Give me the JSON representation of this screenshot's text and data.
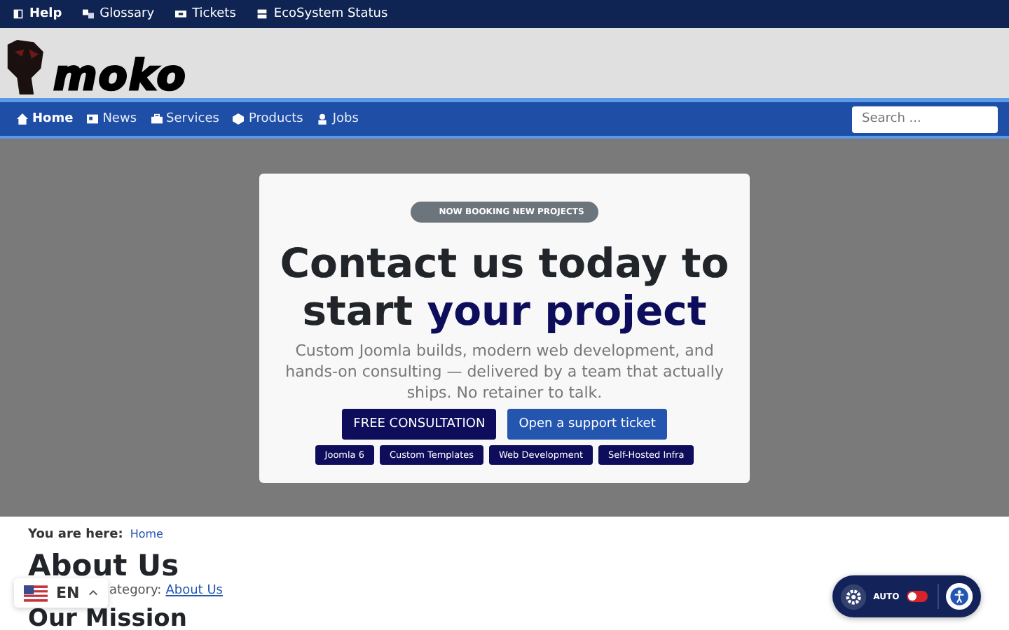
{
  "top_bar": {
    "items": [
      {
        "label": "Help",
        "bold": true
      },
      {
        "label": "Glossary",
        "bold": false
      },
      {
        "label": "Tickets",
        "bold": false
      },
      {
        "label": "EcoSystem Status",
        "bold": false
      }
    ]
  },
  "logo": {
    "text": "moko"
  },
  "nav": {
    "items": [
      {
        "label": "Home",
        "selected": true
      },
      {
        "label": "News",
        "selected": false
      },
      {
        "label": "Services",
        "selected": false
      },
      {
        "label": "Products",
        "selected": false
      },
      {
        "label": "Jobs",
        "selected": false
      }
    ],
    "search": {
      "placeholder": "Search ..."
    }
  },
  "hero": {
    "badge": "NOW BOOKING NEW PROJECTS",
    "title_line_1": "Contact us today to",
    "title_line_2_start": "start ",
    "title_line_2_accent": "your project",
    "text": "Custom Joomla builds, modern web development, and hands-on consulting — delivered by a team that actually ships. No retainer to talk.",
    "buttons": [
      {
        "label": "FREE CONSULTATION",
        "kind": "primary"
      },
      {
        "label": "Open a support ticket",
        "kind": "secondary"
      }
    ],
    "tags": [
      "Joomla 6",
      "Custom Templates",
      "Web Development",
      "Self-Hosted Infra"
    ]
  },
  "breadcrumb": {
    "label": "You are here:",
    "items": [
      "Home"
    ]
  },
  "article": {
    "title": "About Us",
    "category_label": "ategory:",
    "category_link": "About Us",
    "heading": "Our Mission"
  },
  "language": {
    "code": "EN"
  },
  "accessibility": {
    "label": "AUTO",
    "on": false
  }
}
